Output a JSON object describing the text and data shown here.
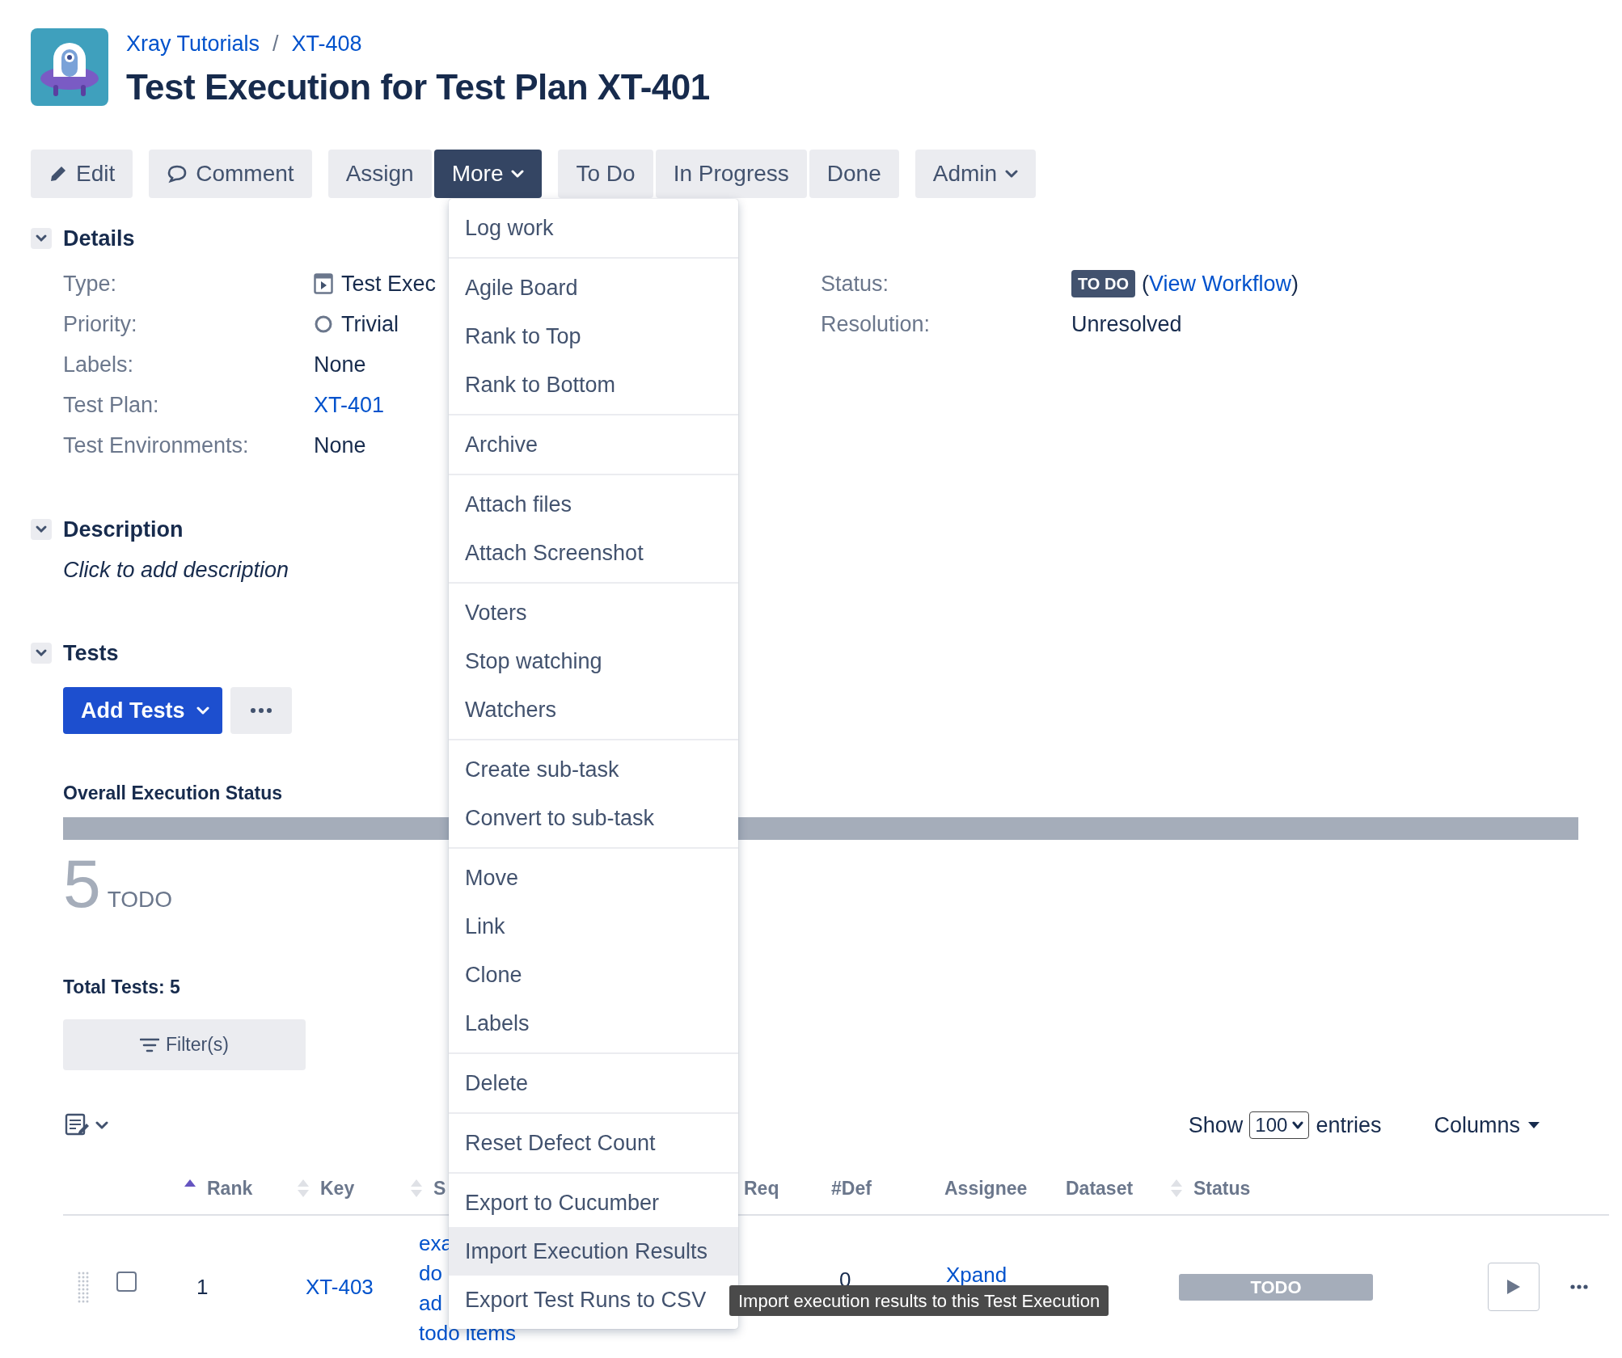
{
  "header": {
    "breadcrumbs": [
      "Xray Tutorials",
      "XT-408"
    ],
    "separator": "/",
    "title": "Test Execution for Test Plan XT-401"
  },
  "toolbar": [
    {
      "buttons": [
        {
          "label": "Edit"
        }
      ]
    },
    {
      "buttons": [
        {
          "label": "Comment"
        }
      ]
    },
    {
      "buttons": [
        {
          "label": "Assign"
        },
        {
          "label": "More",
          "expanded": true
        }
      ]
    },
    {
      "buttons": [
        {
          "label": "To Do"
        },
        {
          "label": "In Progress"
        },
        {
          "label": "Done"
        }
      ]
    },
    {
      "buttons": [
        {
          "label": "Admin",
          "expanded": false
        }
      ]
    }
  ],
  "details": {
    "title": "Details",
    "expanded": true,
    "left_fields": [
      {
        "label": "Type:",
        "value": "Test Exec",
        "kind": "type"
      },
      {
        "label": "Priority:",
        "value": "Trivial",
        "kind": "priority"
      },
      {
        "label": "Labels:",
        "value": "None",
        "kind": "text"
      },
      {
        "label": "Test Plan:",
        "value": "XT-401",
        "kind": "link"
      },
      {
        "label": "Test Environments:",
        "value": "None",
        "kind": "text"
      }
    ],
    "right_fields": [
      {
        "label": "Status:",
        "kind": "status",
        "badge": "TO DO",
        "open": "(",
        "link": "View Workflow",
        "close": ")"
      },
      {
        "label": "Resolution:",
        "kind": "text",
        "value": "Unresolved"
      }
    ]
  },
  "description": {
    "title": "Description",
    "expanded": true,
    "hint": "Click to add description"
  },
  "tests": {
    "title": "Tests",
    "expanded": true,
    "add_button": "Add Tests",
    "overall_label": "Overall Execution Status",
    "progress": {
      "level": 1
    },
    "count": "5",
    "count_label": "TODO",
    "total": "Total Tests: 5",
    "filter_button": "Filter(s)"
  },
  "table": {
    "show_label": "Show",
    "entries_value": "100",
    "entries_label": "entries",
    "columns_button": "Columns",
    "columns": [
      {
        "label": "Rank",
        "sortable": true,
        "sorted": true
      },
      {
        "label": "Key",
        "sortable": true,
        "sorted": false
      },
      {
        "label": "S",
        "sortable": true,
        "sorted": false
      },
      {
        "label": "Req"
      },
      {
        "label": "#Def"
      },
      {
        "label": "Assignee"
      },
      {
        "label": "Dataset"
      },
      {
        "label": "Status",
        "sortable": true,
        "sorted": false
      }
    ],
    "rows": [
      {
        "checked": false,
        "rank": "1",
        "key": "XT-403",
        "summary": [
          "exa",
          "do",
          "ad",
          "todo items"
        ],
        "defects": "0",
        "assignee": "Xpand",
        "status": "TODO"
      }
    ]
  },
  "menu": {
    "groups": [
      {
        "items": [
          {
            "label": "Log work",
            "selected": false
          }
        ]
      },
      {
        "items": [
          {
            "label": "Agile Board",
            "selected": false
          },
          {
            "label": "Rank to Top",
            "selected": false
          },
          {
            "label": "Rank to Bottom",
            "selected": false
          }
        ]
      },
      {
        "items": [
          {
            "label": "Archive",
            "selected": false
          }
        ]
      },
      {
        "items": [
          {
            "label": "Attach files",
            "selected": false
          },
          {
            "label": "Attach Screenshot",
            "selected": false
          }
        ]
      },
      {
        "items": [
          {
            "label": "Voters",
            "selected": false
          },
          {
            "label": "Stop watching",
            "selected": false
          },
          {
            "label": "Watchers",
            "selected": false
          }
        ]
      },
      {
        "items": [
          {
            "label": "Create sub-task",
            "selected": false
          },
          {
            "label": "Convert to sub-task",
            "selected": false
          }
        ]
      },
      {
        "items": [
          {
            "label": "Move",
            "selected": false
          },
          {
            "label": "Link",
            "selected": false
          },
          {
            "label": "Clone",
            "selected": false
          },
          {
            "label": "Labels",
            "selected": false
          }
        ]
      },
      {
        "items": [
          {
            "label": "Delete",
            "selected": false
          }
        ]
      },
      {
        "items": [
          {
            "label": "Reset Defect Count",
            "selected": false
          }
        ]
      },
      {
        "items": [
          {
            "label": "Export to Cucumber",
            "selected": false
          },
          {
            "label": "Import Execution Results",
            "selected": true
          },
          {
            "label": "Export Test Runs to CSV",
            "selected": false
          }
        ]
      }
    ]
  },
  "tooltip": "Import execution results to this Test Execution"
}
